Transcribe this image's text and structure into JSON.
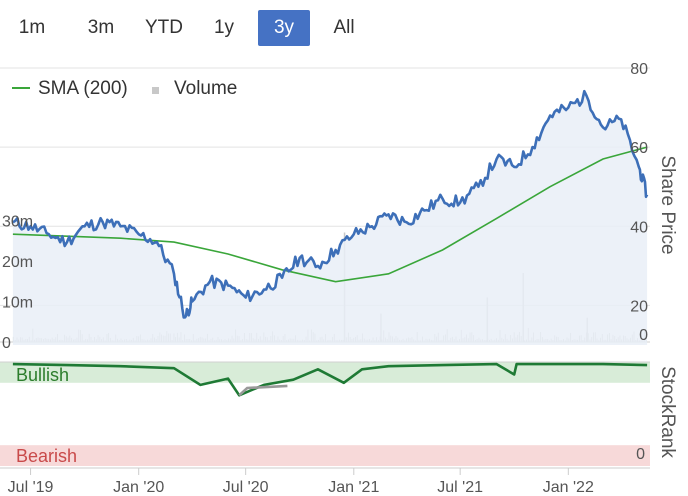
{
  "range_selector": {
    "buttons": [
      {
        "label": "1m"
      },
      {
        "label": "3m"
      },
      {
        "label": "YTD"
      },
      {
        "label": "1y"
      },
      {
        "label": "3y"
      },
      {
        "label": "All"
      }
    ],
    "active": "3y"
  },
  "legend": {
    "sma_label": "SMA (200)",
    "volume_label": "Volume"
  },
  "colors": {
    "price_line": "#3d6fb8",
    "price_fill": "#e9eef7",
    "sma_line": "#3aa63a",
    "volume_bars": "#c8c8c8",
    "bullish_band": "#d8ecd8",
    "bearish_band": "#f7d9d9",
    "stockrank_line": "#1f7a35",
    "stockrank_gray": "#999999",
    "active_button": "#4572c4"
  },
  "chart_data": [
    {
      "type": "line",
      "x_ticks": [
        "Jul '19",
        "Jan '20",
        "Jul '20",
        "Jan '21",
        "Jul '21",
        "Jan '22"
      ],
      "ylabel": "Share Price",
      "y_ticks": [
        "20",
        "40",
        "60",
        "80"
      ],
      "ylim": [
        10,
        80
      ],
      "grid": true,
      "legend_position": "top-left",
      "series": [
        {
          "name": "SMA (200)",
          "x": [
            "2019-06-01",
            "2019-09-01",
            "2019-12-01",
            "2020-03-01",
            "2020-06-01",
            "2020-09-01",
            "2020-12-01",
            "2021-03-01",
            "2021-06-01",
            "2021-09-01",
            "2021-12-01",
            "2022-03-01",
            "2022-05-15"
          ],
          "values": [
            38,
            37.5,
            37,
            36,
            33,
            29,
            26,
            28,
            34,
            42,
            50,
            57,
            60
          ]
        }
      ],
      "price_series": {
        "x": [
          "2019-06-01",
          "2019-07-01",
          "2019-08-01",
          "2019-09-01",
          "2019-10-01",
          "2019-11-01",
          "2019-12-01",
          "2020-01-01",
          "2020-02-01",
          "2020-03-01",
          "2020-03-20",
          "2020-04-01",
          "2020-05-01",
          "2020-06-01",
          "2020-07-01",
          "2020-08-01",
          "2020-09-01",
          "2020-10-01",
          "2020-11-01",
          "2020-12-01",
          "2021-01-01",
          "2021-02-01",
          "2021-03-01",
          "2021-04-01",
          "2021-05-01",
          "2021-06-01",
          "2021-07-01",
          "2021-08-01",
          "2021-09-01",
          "2021-10-01",
          "2021-11-01",
          "2021-12-01",
          "2022-01-01",
          "2022-02-01",
          "2022-03-01",
          "2022-04-01",
          "2022-05-01",
          "2022-05-15"
        ],
        "values": [
          41,
          40,
          38,
          36,
          40,
          41,
          40,
          38,
          36,
          28,
          17,
          21,
          26,
          25,
          22,
          24,
          27,
          32,
          30,
          34,
          38,
          40,
          43,
          41,
          44,
          47,
          46,
          50,
          57,
          55,
          60,
          68,
          70,
          73,
          65,
          67,
          55,
          48
        ]
      },
      "volume_ticks": [
        "0",
        "10m",
        "20m",
        "30m"
      ],
      "volume_ylim": [
        0,
        35
      ],
      "volume_right_tick": "0",
      "volume_spikes": [
        {
          "x": "2020-12-15",
          "value": 27
        },
        {
          "x": "2021-10-15",
          "value": 17
        },
        {
          "x": "2021-08-15",
          "value": 11
        },
        {
          "x": "2021-02-15",
          "value": 7
        },
        {
          "x": "2022-02-01",
          "value": 6
        }
      ]
    },
    {
      "type": "line",
      "ylabel": "StockRank",
      "y_ticks": [
        "0"
      ],
      "ylim": [
        0,
        100
      ],
      "bands": [
        {
          "label": "Bullish",
          "range": [
            80,
            100
          ]
        },
        {
          "label": "Bearish",
          "range": [
            0,
            20
          ]
        }
      ],
      "series": [
        {
          "name": "StockRank",
          "x": [
            "2019-06-01",
            "2019-09-01",
            "2019-12-01",
            "2020-03-01",
            "2020-04-15",
            "2020-06-01",
            "2020-06-20",
            "2020-08-01",
            "2020-09-20",
            "2020-11-01",
            "2020-12-15",
            "2021-01-15",
            "2021-03-01",
            "2021-06-01",
            "2021-09-01",
            "2021-10-01",
            "2021-10-05",
            "2021-12-01",
            "2022-03-01",
            "2022-05-15"
          ],
          "values": [
            98,
            97,
            96,
            94,
            78,
            84,
            68,
            78,
            83,
            93,
            80,
            93,
            96,
            97,
            98,
            88,
            98,
            98,
            98,
            97
          ]
        }
      ]
    }
  ]
}
